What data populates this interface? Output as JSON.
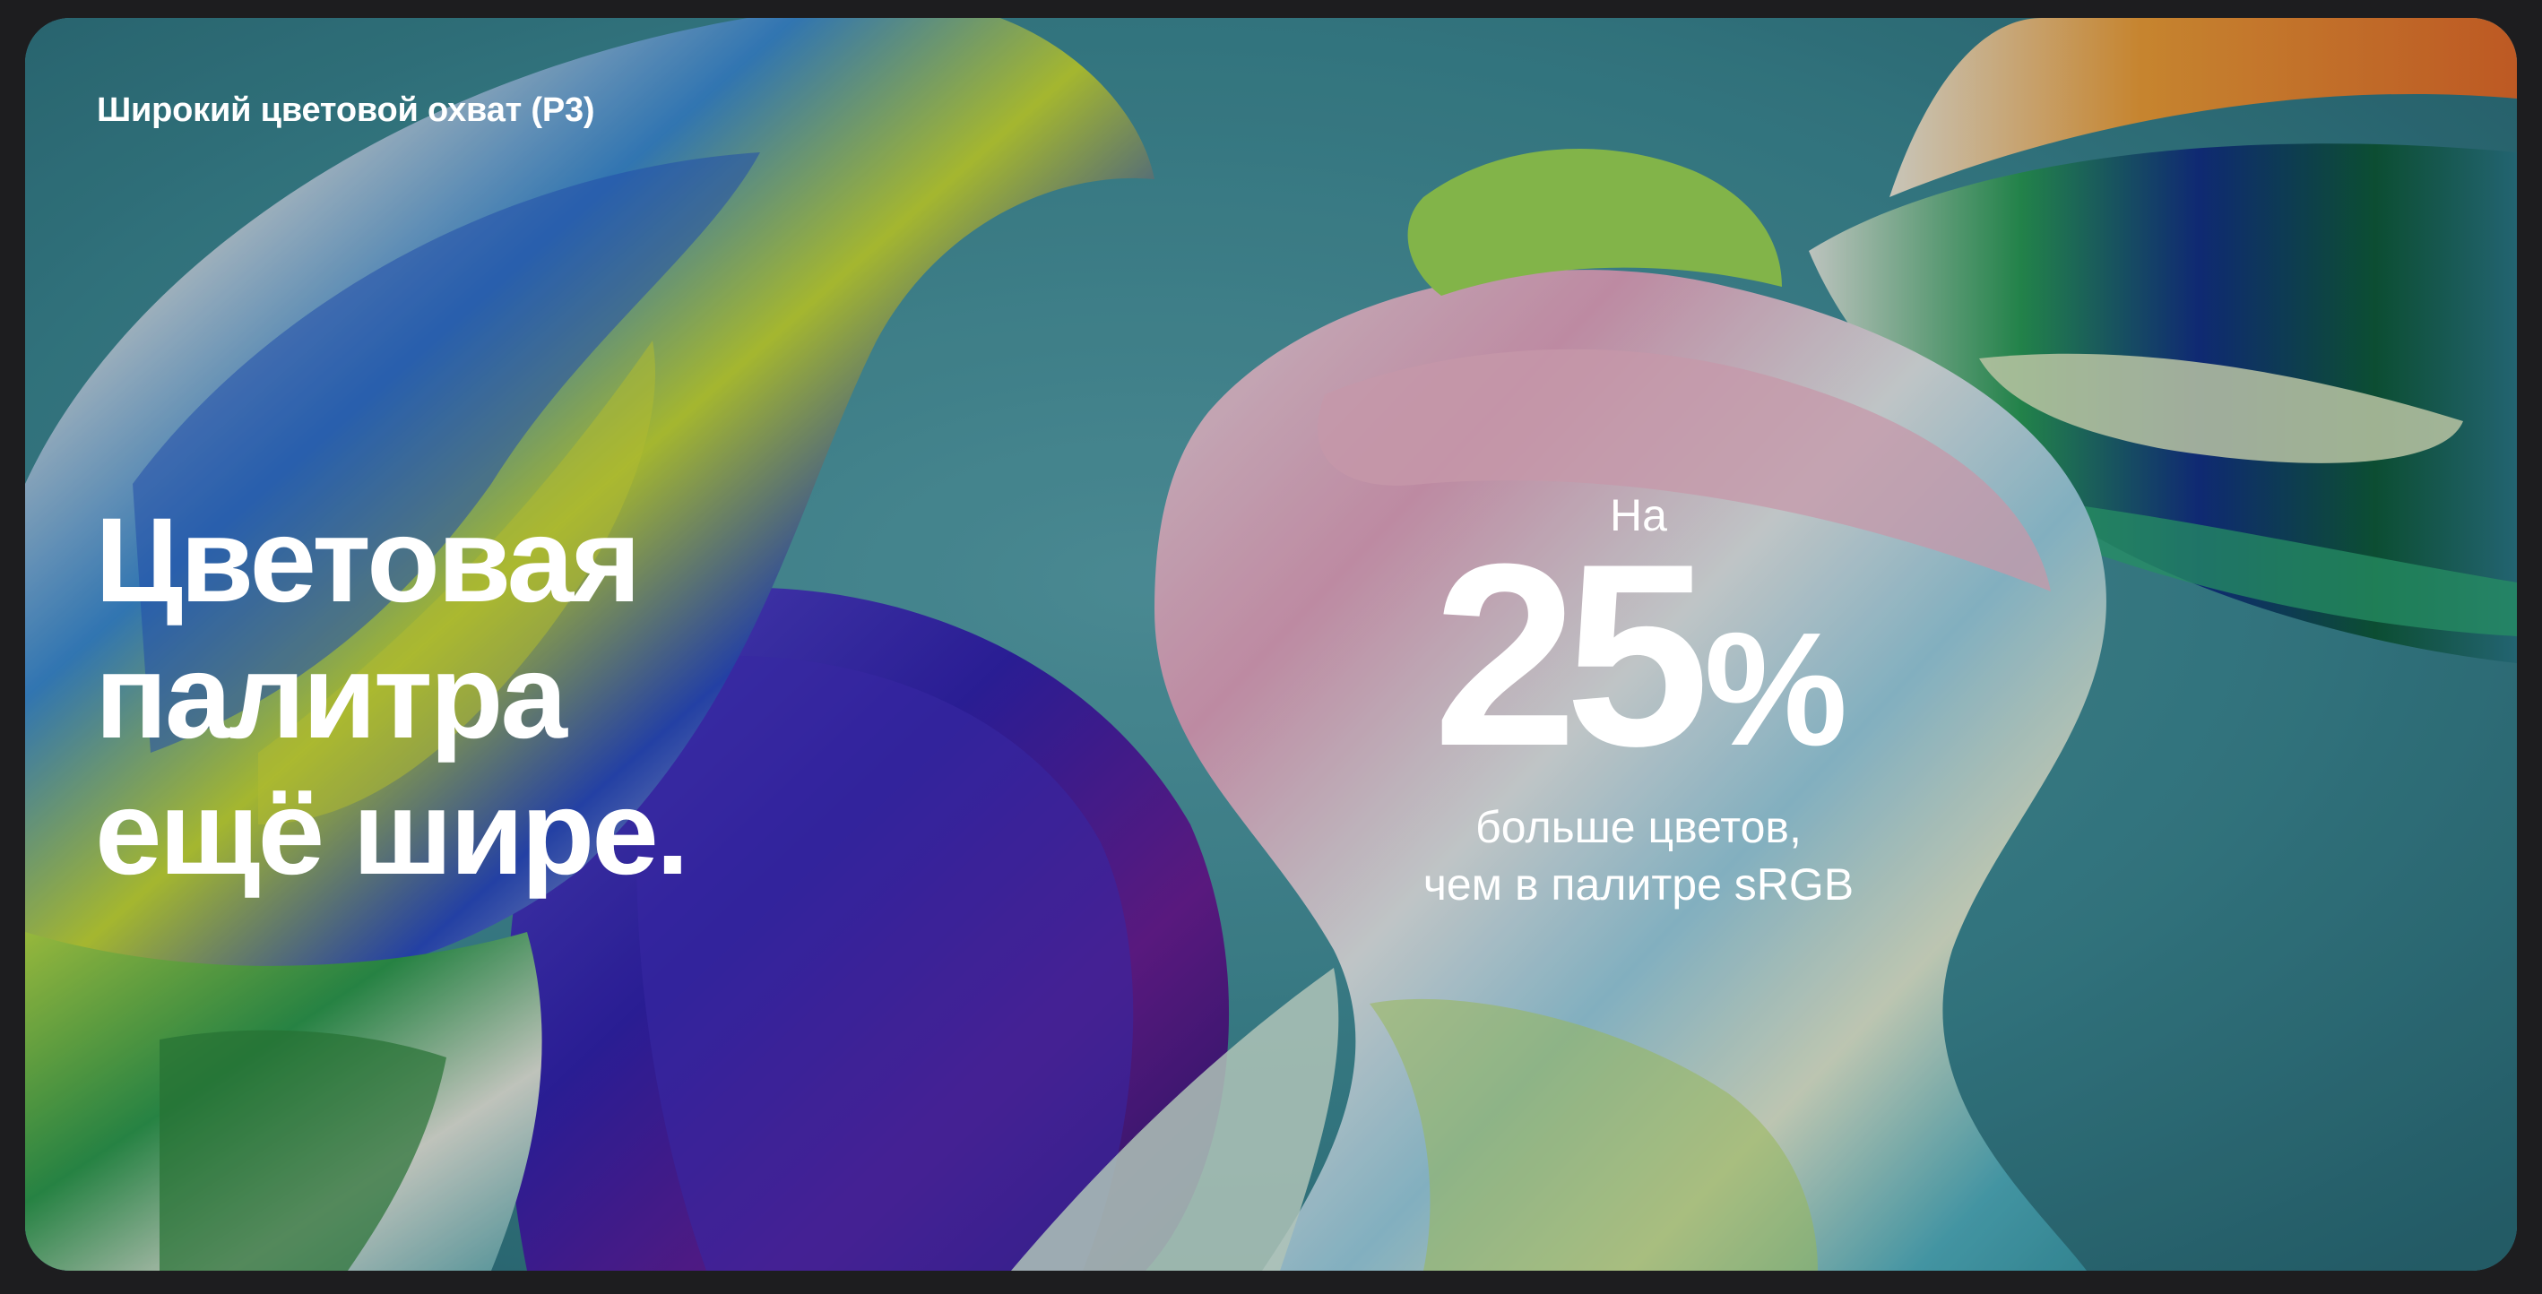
{
  "tile": {
    "eyebrow": "Широкий цветовой охват (P3)",
    "headline": [
      "Цветовая",
      "палитра",
      "ещё шире."
    ],
    "stat": {
      "prefix": "На",
      "number": "25",
      "unit": "%",
      "caption": [
        "больше цветов,",
        "чем в палитре sRGB"
      ]
    }
  },
  "colors": {
    "page_background": "#1d1d1f",
    "tile_background": "#3f8e9b",
    "text": "#ffffff"
  }
}
